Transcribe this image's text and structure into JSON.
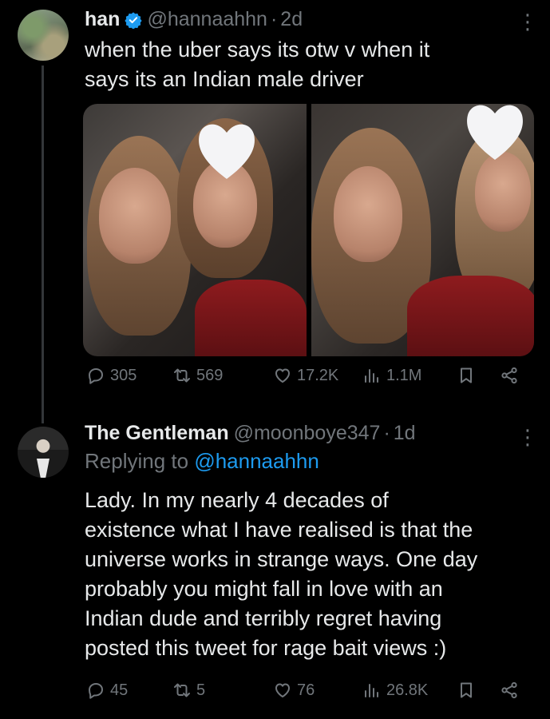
{
  "tweet": {
    "author_name": "han",
    "handle": "@hannaahhn",
    "time": "2d",
    "text_line1": "when the uber says its otw v when it",
    "text_line2": "says its an Indian male driver",
    "replies": "305",
    "retweets": "569",
    "likes": "17.2K",
    "views": "1.1M",
    "media": {
      "photo_count": 2
    }
  },
  "reply": {
    "author_name": "The Gentleman",
    "handle": "@moonboye347",
    "time": "1d",
    "replying_prefix": "Replying to",
    "replying_to": "@hannaahhn",
    "lines": [
      "Lady. In my nearly 4 decades of",
      "existence what I have realised is that the",
      "universe works in strange ways. One day",
      "probably you might fall in love with an",
      "Indian dude and terribly regret having",
      "posted this tweet for rage bait views :)"
    ],
    "replies": "45",
    "retweets": "5",
    "likes": "76",
    "views": "26.8K"
  },
  "separator": "·",
  "colors": {
    "background": "#000000",
    "text": "#e7e9ea",
    "muted": "#71767b",
    "link": "#1d9bf0",
    "verified": "#1d9bf0"
  },
  "icons": [
    "reply-icon",
    "retweet-icon",
    "like-icon",
    "views-icon",
    "bookmark-icon",
    "share-icon",
    "more-icon",
    "verified-badge-icon"
  ]
}
